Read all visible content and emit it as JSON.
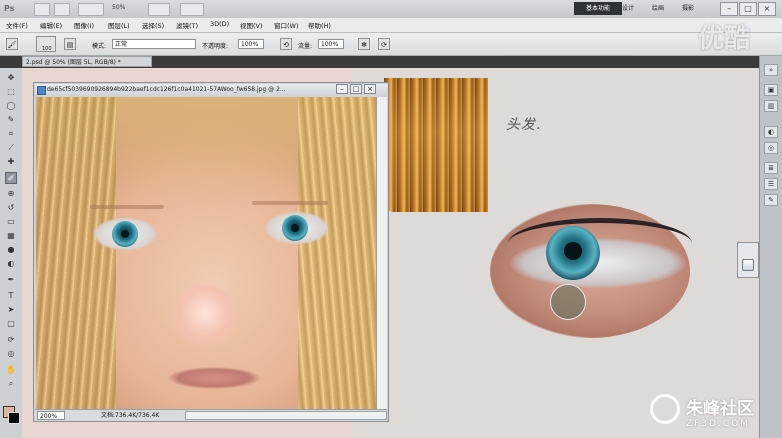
{
  "app": {
    "logo": "Ps",
    "zoom": "50%",
    "workspaces": [
      "基本功能",
      "设计",
      "绘画",
      "摄影"
    ],
    "window_controls": [
      "–",
      "□",
      "×"
    ]
  },
  "menubar": {
    "items": [
      "文件(F)",
      "编辑(E)",
      "图像(I)",
      "图层(L)",
      "选择(S)",
      "滤镜(T)",
      "3D(D)",
      "视图(V)",
      "窗口(W)",
      "帮助(H)"
    ]
  },
  "options_bar": {
    "brush_size": "100",
    "mode_label": "模式:",
    "mode_value": "正常",
    "opacity_label": "不透明度:",
    "opacity_value": "100%",
    "flow_label": "流量:",
    "flow_value": "100%"
  },
  "document_tab": {
    "title": "2.psd @ 50% (图层 5L, RGB/8) *"
  },
  "photo_window": {
    "title": "de65cf5039690926894b922baef1cdc126f1c0a41021-57AWoo_fw658.jpg @ 2...",
    "zoom": "200%",
    "info": "文档:736.4K/736.4K"
  },
  "canvas": {
    "annotation": "头发."
  },
  "toolbar": {
    "tools": [
      "move-tool",
      "marquee-tool",
      "lasso-tool",
      "quick-select-tool",
      "crop-tool",
      "eyedropper-tool",
      "healing-tool",
      "brush-tool",
      "clone-stamp-tool",
      "history-brush-tool",
      "eraser-tool",
      "gradient-tool",
      "blur-tool",
      "dodge-tool",
      "pen-tool",
      "type-tool",
      "path-select-tool",
      "shape-tool",
      "3d-rotate-tool",
      "3d-orbit-tool",
      "hand-tool",
      "zoom-tool"
    ],
    "active_tool": "brush-tool",
    "foreground_color": "#e0b6a0",
    "background_color": "#000000"
  },
  "watermarks": {
    "top": "优酷",
    "bottom_zh": "朱峰社区",
    "bottom_en": "ZF3D.COM"
  }
}
